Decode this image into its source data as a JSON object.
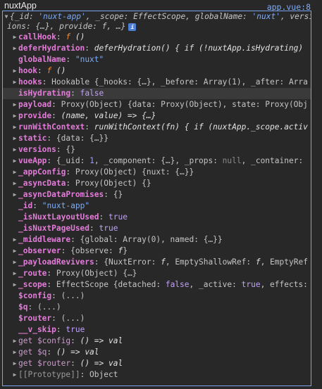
{
  "header": {
    "title": "nuxtApp",
    "source": "app.vue:8"
  },
  "summary": {
    "line1": "{_id: 'nuxt-app', _scope: EffectScope, globalName: 'nuxt', versions: {…}, provide: f, …}",
    "line1a": "{_id: ",
    "line1b": "'nuxt-app'",
    "line1c": ", _scope: EffectScope, globalName: ",
    "line1d": "'nuxt'",
    "line1e": ", versi",
    "line2": "ions: {…}, provide: f, …}"
  },
  "rows": [
    {
      "arrow": "right",
      "key": "callHook",
      "keyStyle": "bold",
      "parts": [
        {
          "t": "f",
          "c": "fn-f"
        },
        {
          "t": " ()",
          "c": "fn-body"
        }
      ]
    },
    {
      "arrow": "right",
      "key": "deferHydration",
      "keyStyle": "bold",
      "parts": [
        {
          "t": "deferHydration() { if (!nuxtApp.isHydrating)",
          "c": "fn-body"
        }
      ]
    },
    {
      "arrow": "",
      "key": "globalName",
      "keyStyle": "bold",
      "parts": [
        {
          "t": "\"nuxt\"",
          "c": "str"
        }
      ]
    },
    {
      "arrow": "right",
      "key": "hook",
      "keyStyle": "bold",
      "parts": [
        {
          "t": "f",
          "c": "fn-f"
        },
        {
          "t": " ()",
          "c": "fn-body"
        }
      ]
    },
    {
      "arrow": "right",
      "key": "hooks",
      "keyStyle": "bold",
      "parts": [
        {
          "t": "Hookable ",
          "c": "type"
        },
        {
          "t": "{_hooks: {…}, _before: Array(1), _after: Arra",
          "c": "muted"
        }
      ]
    },
    {
      "arrow": "",
      "key": "isHydrating",
      "keyStyle": "bold",
      "hl": true,
      "parts": [
        {
          "t": "false",
          "c": "kw"
        }
      ]
    },
    {
      "arrow": "right",
      "key": "payload",
      "keyStyle": "bold",
      "parts": [
        {
          "t": "Proxy(Object) ",
          "c": "type"
        },
        {
          "t": "{data: Proxy(Object), state: Proxy(Obj",
          "c": "muted"
        }
      ]
    },
    {
      "arrow": "right",
      "key": "provide",
      "keyStyle": "bold",
      "parts": [
        {
          "t": "(name, value) => {…}",
          "c": "fn-body"
        }
      ]
    },
    {
      "arrow": "right",
      "key": "runWithContext",
      "keyStyle": "bold",
      "parts": [
        {
          "t": "runWithContext(fn) { if (nuxtApp._scope.activ",
          "c": "fn-body"
        }
      ]
    },
    {
      "arrow": "right",
      "key": "static",
      "keyStyle": "bold",
      "parts": [
        {
          "t": "{data: {…}}",
          "c": "muted"
        }
      ]
    },
    {
      "arrow": "right",
      "key": "versions",
      "keyStyle": "bold",
      "parts": [
        {
          "t": "{}",
          "c": "muted"
        }
      ]
    },
    {
      "arrow": "right",
      "key": "vueApp",
      "keyStyle": "bold",
      "parts": [
        {
          "t": "{_uid: ",
          "c": "muted"
        },
        {
          "t": "1",
          "c": "num"
        },
        {
          "t": ", _component: {…}, _props: ",
          "c": "muted"
        },
        {
          "t": "null",
          "c": "null"
        },
        {
          "t": ", _container: ",
          "c": "muted"
        }
      ]
    },
    {
      "arrow": "right",
      "key": "_appConfig",
      "keyStyle": "bold",
      "parts": [
        {
          "t": "Proxy(Object) ",
          "c": "type"
        },
        {
          "t": "{nuxt: {…}}",
          "c": "muted"
        }
      ]
    },
    {
      "arrow": "right",
      "key": "_asyncData",
      "keyStyle": "bold",
      "parts": [
        {
          "t": "Proxy(Object) ",
          "c": "type"
        },
        {
          "t": "{}",
          "c": "muted"
        }
      ]
    },
    {
      "arrow": "right",
      "key": "_asyncDataPromises",
      "keyStyle": "bold",
      "parts": [
        {
          "t": "{}",
          "c": "muted"
        }
      ]
    },
    {
      "arrow": "",
      "key": "_id",
      "keyStyle": "bold",
      "parts": [
        {
          "t": "\"nuxt-app\"",
          "c": "str"
        }
      ]
    },
    {
      "arrow": "",
      "key": "_isNuxtLayoutUsed",
      "keyStyle": "bold",
      "parts": [
        {
          "t": "true",
          "c": "kw"
        }
      ]
    },
    {
      "arrow": "",
      "key": "_isNuxtPageUsed",
      "keyStyle": "bold",
      "parts": [
        {
          "t": "true",
          "c": "kw"
        }
      ]
    },
    {
      "arrow": "right",
      "key": "_middleware",
      "keyStyle": "bold",
      "parts": [
        {
          "t": "{global: Array(0), named: {…}}",
          "c": "muted"
        }
      ]
    },
    {
      "arrow": "right",
      "key": "_observer",
      "keyStyle": "bold",
      "parts": [
        {
          "t": "{observe: ",
          "c": "muted"
        },
        {
          "t": "f",
          "c": "fn-body"
        },
        {
          "t": "}",
          "c": "muted"
        }
      ]
    },
    {
      "arrow": "right",
      "key": "_payloadRevivers",
      "keyStyle": "bold",
      "parts": [
        {
          "t": "{NuxtError: ",
          "c": "muted"
        },
        {
          "t": "f",
          "c": "fn-body"
        },
        {
          "t": ", EmptyShallowRef: ",
          "c": "muted"
        },
        {
          "t": "f",
          "c": "fn-body"
        },
        {
          "t": ", EmptyRef",
          "c": "muted"
        }
      ]
    },
    {
      "arrow": "right",
      "key": "_route",
      "keyStyle": "bold",
      "parts": [
        {
          "t": "Proxy(Object) ",
          "c": "type"
        },
        {
          "t": "{…}",
          "c": "muted"
        }
      ]
    },
    {
      "arrow": "right",
      "key": "_scope",
      "keyStyle": "bold",
      "parts": [
        {
          "t": "EffectScope ",
          "c": "type"
        },
        {
          "t": "{detached: ",
          "c": "muted"
        },
        {
          "t": "false",
          "c": "kw"
        },
        {
          "t": ", _active: ",
          "c": "muted"
        },
        {
          "t": "true",
          "c": "kw"
        },
        {
          "t": ", effects:",
          "c": "muted"
        }
      ]
    },
    {
      "arrow": "",
      "key": "$config",
      "keyStyle": "bold",
      "parts": [
        {
          "t": "(...)",
          "c": "muted"
        }
      ]
    },
    {
      "arrow": "",
      "key": "$q",
      "keyStyle": "bold",
      "parts": [
        {
          "t": "(...)",
          "c": "muted"
        }
      ]
    },
    {
      "arrow": "",
      "key": "$router",
      "keyStyle": "bold",
      "parts": [
        {
          "t": "(...)",
          "c": "muted"
        }
      ]
    },
    {
      "arrow": "",
      "key": "__v_skip",
      "keyStyle": "bold",
      "parts": [
        {
          "t": "true",
          "c": "kw"
        }
      ]
    },
    {
      "arrow": "right",
      "key": "get $config",
      "keyStyle": "dim",
      "parts": [
        {
          "t": "() => val",
          "c": "fn-body"
        }
      ]
    },
    {
      "arrow": "right",
      "key": "get $q",
      "keyStyle": "dim",
      "parts": [
        {
          "t": "() => val",
          "c": "fn-body"
        }
      ]
    },
    {
      "arrow": "right",
      "key": "get $router",
      "keyStyle": "dim",
      "parts": [
        {
          "t": "() => val",
          "c": "fn-body"
        }
      ]
    },
    {
      "arrow": "right",
      "key": "[[Prototype]]",
      "keyStyle": "proto",
      "parts": [
        {
          "t": "Object",
          "c": "muted"
        }
      ]
    }
  ],
  "info_badge": "i",
  "colors": {
    "background": "#282828",
    "border": "#7ba4ee",
    "key": "#e37bd9",
    "string": "#7cacf8",
    "keyword": "#c0a0f8",
    "function_marker": "#f48a2d"
  },
  "icons": {
    "collapsed": "triangle-right-icon",
    "expanded": "triangle-down-icon"
  }
}
